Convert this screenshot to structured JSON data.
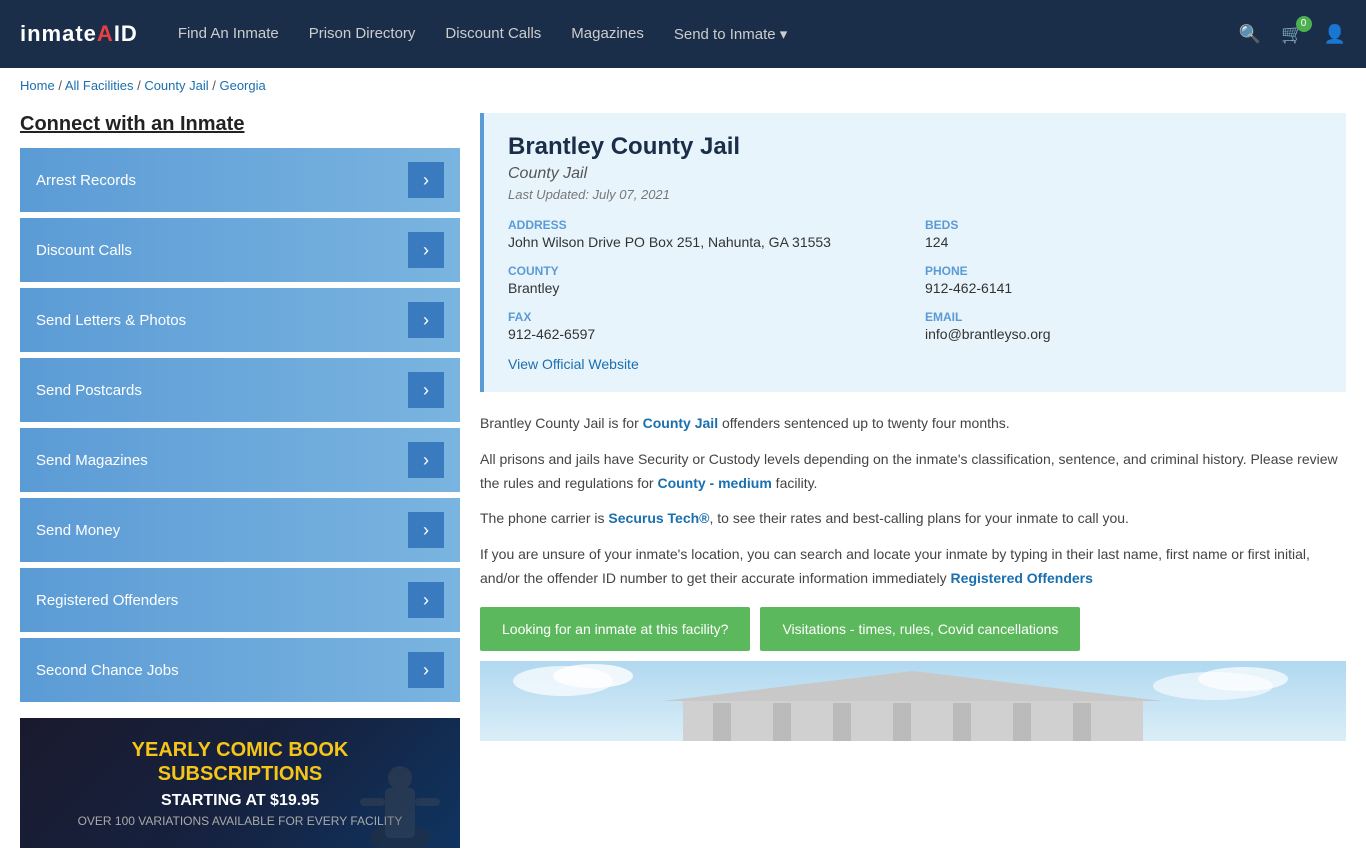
{
  "nav": {
    "logo_text": "inmateAID",
    "links": [
      {
        "label": "Find An Inmate",
        "id": "find-inmate"
      },
      {
        "label": "Prison Directory",
        "id": "prison-directory"
      },
      {
        "label": "Discount Calls",
        "id": "discount-calls"
      },
      {
        "label": "Magazines",
        "id": "magazines"
      },
      {
        "label": "Send to Inmate ▾",
        "id": "send-to-inmate"
      }
    ],
    "cart_count": "0"
  },
  "breadcrumb": {
    "home": "Home",
    "separator1": " / ",
    "all_facilities": "All Facilities",
    "separator2": " / ",
    "county_jail": "County Jail",
    "separator3": " / ",
    "state": "Georgia"
  },
  "sidebar": {
    "title": "Connect with an Inmate",
    "items": [
      {
        "label": "Arrest Records",
        "id": "arrest-records"
      },
      {
        "label": "Discount Calls",
        "id": "discount-calls"
      },
      {
        "label": "Send Letters & Photos",
        "id": "send-letters"
      },
      {
        "label": "Send Postcards",
        "id": "send-postcards"
      },
      {
        "label": "Send Magazines",
        "id": "send-magazines"
      },
      {
        "label": "Send Money",
        "id": "send-money"
      },
      {
        "label": "Registered Offenders",
        "id": "registered-offenders"
      },
      {
        "label": "Second Chance Jobs",
        "id": "second-chance-jobs"
      }
    ],
    "ad": {
      "line1": "YEARLY COMIC BOOK",
      "line2": "SUBSCRIPTIONS",
      "line3": "STARTING AT $19.95",
      "line4": "OVER 100 VARIATIONS AVAILABLE FOR EVERY FACILITY"
    }
  },
  "facility": {
    "name": "Brantley County Jail",
    "type": "County Jail",
    "last_updated": "Last Updated: July 07, 2021",
    "address_label": "ADDRESS",
    "address_value": "John Wilson Drive PO Box 251, Nahunta, GA 31553",
    "beds_label": "BEDS",
    "beds_value": "124",
    "county_label": "COUNTY",
    "county_value": "Brantley",
    "phone_label": "PHONE",
    "phone_value": "912-462-6141",
    "fax_label": "FAX",
    "fax_value": "912-462-6597",
    "email_label": "EMAIL",
    "email_value": "info@brantleyso.org",
    "website_label": "View Official Website"
  },
  "description": {
    "para1": "Brantley County Jail is for ",
    "para1_link": "County Jail",
    "para1_rest": " offenders sentenced up to twenty four months.",
    "para2": "All prisons and jails have Security or Custody levels depending on the inmate's classification, sentence, and criminal history. Please review the rules and regulations for ",
    "para2_link": "County - medium",
    "para2_rest": " facility.",
    "para3": "The phone carrier is ",
    "para3_link": "Securus Tech®",
    "para3_rest": ", to see their rates and best-calling plans for your inmate to call you.",
    "para4_start": "If you are unsure of your inmate's location, you can search and locate your inmate by typing in their last name, first name or first initial, and/or the offender ID number to get their accurate information immediately ",
    "para4_link": "Registered Offenders"
  },
  "buttons": {
    "looking_for_inmate": "Looking for an inmate at this facility?",
    "visitations": "Visitations - times, rules, Covid cancellations"
  }
}
